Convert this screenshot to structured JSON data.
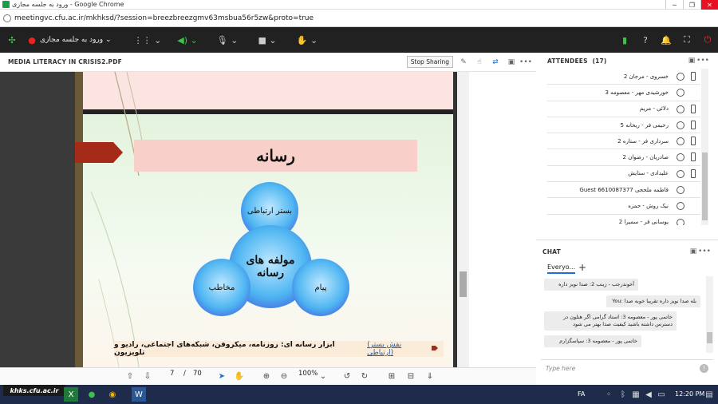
{
  "browser": {
    "window_title": "ورود به جلسه مجازی - Google Chrome",
    "url": "meetingvc.cfu.ac.ir/mkhksd/?session=breezbreezgmv63msbua56r5zw&proto=true"
  },
  "toolbar": {
    "meeting_label": "ورود به جلسه مجازی"
  },
  "media_panel": {
    "title": "MEDIA LITERACY IN CRISIS2.PDF",
    "stop_sharing": "Stop Sharing"
  },
  "slide": {
    "heading": "رسانه",
    "circle_top": "بستر ارتباطی",
    "circle_center": "مولفه های رسانه",
    "circle_left": "مخاطب",
    "circle_right": "پیام",
    "footnote_text": "ابزار رسانه ای: روزنامه، میکروفن، شبکه‌های اجتماعی، رادیو و تلویزیون",
    "footnote_link": "(نقش بستر ارتباطی)"
  },
  "pdf_nav": {
    "current_page": "7",
    "separator": "/",
    "total_pages": "70",
    "zoom": "100%"
  },
  "attendees": {
    "title": "ATTENDEES",
    "count": "(17)",
    "list": [
      {
        "name": "خسروی - مرجان 2",
        "devices": [
          "globe",
          "phone"
        ]
      },
      {
        "name": "خورشیدی مهر - معصومه 3",
        "devices": [
          "globe"
        ]
      },
      {
        "name": "دلائی - مریم",
        "devices": [
          "globe",
          "phone"
        ]
      },
      {
        "name": "رحیمی فر - ریحانه 5",
        "devices": [
          "globe",
          "phone"
        ]
      },
      {
        "name": "سرداری فر - ستاره 2",
        "devices": [
          "globe",
          "phone"
        ]
      },
      {
        "name": "صادریان - رضوان 2",
        "devices": [
          "globe",
          "phone"
        ]
      },
      {
        "name": "علیدادی - ستایش",
        "devices": [
          "globe",
          "phone"
        ]
      },
      {
        "name": "Guest فاطمه ملحجی 6610087377",
        "devices": [
          "globe"
        ]
      },
      {
        "name": "نیک روش - حمزه",
        "devices": [
          "globe"
        ]
      },
      {
        "name": "یوسانی فر - سمیرا 2",
        "devices": [
          "globe"
        ]
      }
    ]
  },
  "chat": {
    "title": "CHAT",
    "tab": "Everyo...",
    "add": "+",
    "messages": [
      "آخوندرجب - زینب 2: صدا نویز داره",
      "You: بله صدا نویز داره تقریبا خوبه صدا",
      "خاتمی پور - معصومه 3: استاد گرامی اگر هنلون در دسترس داشته باشید کیفیت صدا بهتر می شود",
      "خاتمی پور - معصومه 3: سپاسگزارم"
    ],
    "placeholder": "Type here"
  },
  "taskbar": {
    "lang": "FA",
    "time": "12:20 PM",
    "watermark": "khks.cfu.ac.ir"
  },
  "colors": {
    "toolbar_bg": "#212121",
    "slide_heading_bg": "#f9cfc9",
    "arrow": "#a52b18",
    "circle_blue": "#3a3fd6",
    "taskbar": "#1e2b4b"
  }
}
